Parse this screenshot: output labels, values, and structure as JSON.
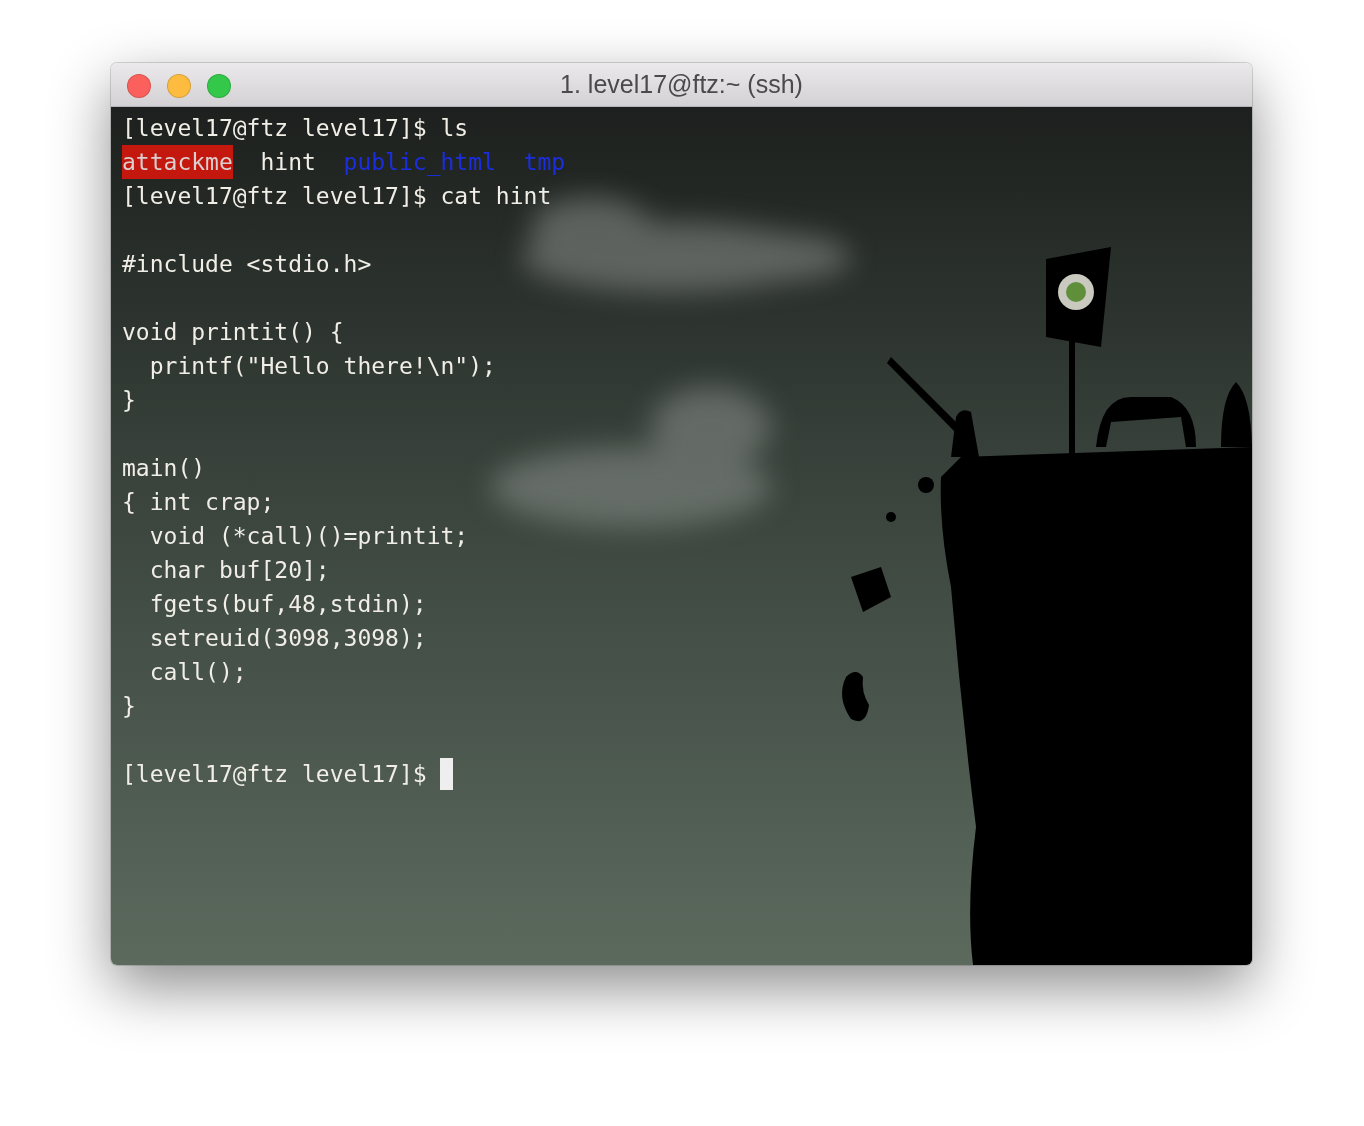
{
  "window": {
    "title": "1. level17@ftz:~ (ssh)"
  },
  "terminal": {
    "lines": [
      {
        "kind": "text",
        "segments": [
          {
            "kind": "plain",
            "text": "[level17@ftz level17]$ ls"
          }
        ]
      },
      {
        "kind": "listing",
        "segments": [
          {
            "kind": "executable",
            "text": "attackme"
          },
          {
            "kind": "plain",
            "text": "hint"
          },
          {
            "kind": "directory",
            "text": "public_html"
          },
          {
            "kind": "directory",
            "text": "tmp"
          }
        ]
      },
      {
        "kind": "text",
        "segments": [
          {
            "kind": "plain",
            "text": "[level17@ftz level17]$ cat hint"
          }
        ]
      },
      {
        "kind": "blank"
      },
      {
        "kind": "text",
        "segments": [
          {
            "kind": "plain",
            "text": "#include <stdio.h>"
          }
        ]
      },
      {
        "kind": "blank"
      },
      {
        "kind": "text",
        "segments": [
          {
            "kind": "plain",
            "text": "void printit() {"
          }
        ]
      },
      {
        "kind": "text",
        "segments": [
          {
            "kind": "plain",
            "text": "  printf(\"Hello there!\\n\");"
          }
        ]
      },
      {
        "kind": "text",
        "segments": [
          {
            "kind": "plain",
            "text": "}"
          }
        ]
      },
      {
        "kind": "blank"
      },
      {
        "kind": "text",
        "segments": [
          {
            "kind": "plain",
            "text": "main()"
          }
        ]
      },
      {
        "kind": "text",
        "segments": [
          {
            "kind": "plain",
            "text": "{ int crap;"
          }
        ]
      },
      {
        "kind": "text",
        "segments": [
          {
            "kind": "plain",
            "text": "  void (*call)()=printit;"
          }
        ]
      },
      {
        "kind": "text",
        "segments": [
          {
            "kind": "plain",
            "text": "  char buf[20];"
          }
        ]
      },
      {
        "kind": "text",
        "segments": [
          {
            "kind": "plain",
            "text": "  fgets(buf,48,stdin);"
          }
        ]
      },
      {
        "kind": "text",
        "segments": [
          {
            "kind": "plain",
            "text": "  setreuid(3098,3098);"
          }
        ]
      },
      {
        "kind": "text",
        "segments": [
          {
            "kind": "plain",
            "text": "  call();"
          }
        ]
      },
      {
        "kind": "text",
        "segments": [
          {
            "kind": "plain",
            "text": "}"
          }
        ]
      },
      {
        "kind": "blank"
      },
      {
        "kind": "prompt",
        "cursor": true,
        "segments": [
          {
            "kind": "plain",
            "text": "[level17@ftz level17]$"
          }
        ]
      }
    ]
  }
}
